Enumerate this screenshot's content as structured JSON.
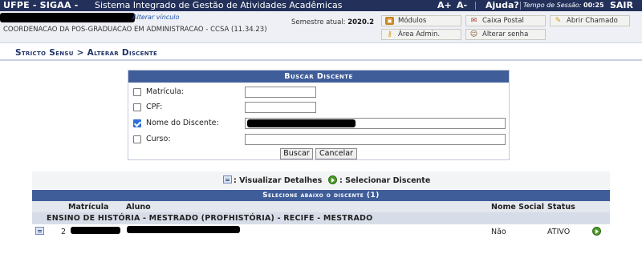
{
  "topbar": {
    "system": "UFPE - SIGAA -",
    "system_name": "Sistema Integrado de Gestão de Atividades Acadêmicas",
    "font_increase": "A+",
    "font_decrease": "A-",
    "help": "Ajuda?",
    "session_label": "Tempo de Sessão:",
    "session_time": "00:25",
    "logout": "SAIR"
  },
  "info": {
    "alterar_vinculo": "Alterar vínculo",
    "coordination": "COORDENACAO DA POS-GRADUACAO EM ADMINISTRACAO - CCSA (11.34.23)",
    "semester_label": "Semestre atual:",
    "semester_value": "2020.2"
  },
  "menu": {
    "modulos": "Módulos",
    "caixa_postal": "Caixa Postal",
    "abrir_chamado": "Abrir Chamado",
    "area_admin": "Área Admin.",
    "alterar_senha": "Alterar senha"
  },
  "breadcrumb": "Stricto Sensu > Alterar Discente",
  "search": {
    "title": "Buscar Discente",
    "fields": {
      "matricula": {
        "label": "Matrícula:",
        "checked": false
      },
      "cpf": {
        "label": "CPF:",
        "checked": false
      },
      "nome": {
        "label": "Nome do Discente:",
        "checked": true
      },
      "curso": {
        "label": "Curso:",
        "checked": false
      }
    },
    "buscar": "Buscar",
    "cancelar": "Cancelar"
  },
  "legend": {
    "detalhes": ": Visualizar Detalhes",
    "selecionar": ": Selecionar Discente"
  },
  "results": {
    "title": "Selecione abaixo o discente (1)",
    "columns": {
      "matricula": "Matrícula",
      "aluno": "Aluno",
      "nome_social": "Nome Social",
      "status": "Status"
    },
    "group": "ENSINO DE HISTÓRIA - MESTRADO (PROFHISTÓRIA) - RECIFE - MESTRADO",
    "rows": [
      {
        "matricula_prefix": "2",
        "nome_social": "Não",
        "status": "ATIVO"
      }
    ]
  }
}
